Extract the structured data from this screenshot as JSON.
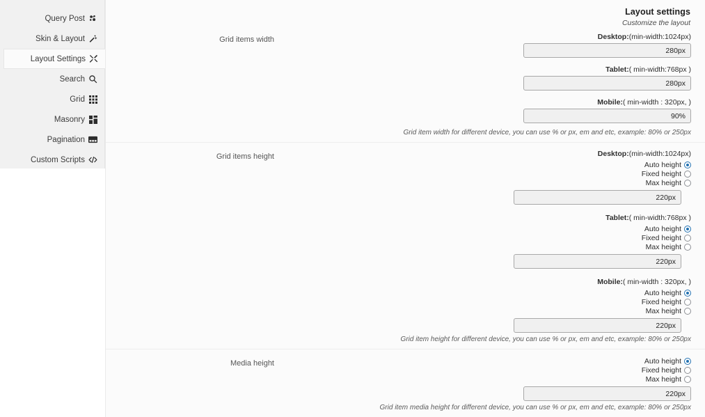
{
  "sidebar": {
    "items": [
      {
        "label": "Query Post",
        "icon": "query-post-icon",
        "active": false
      },
      {
        "label": "Skin & Layout",
        "icon": "magic-wand-icon",
        "active": false
      },
      {
        "label": "Layout Settings",
        "icon": "tools-icon",
        "active": true
      },
      {
        "label": "Search",
        "icon": "search-icon",
        "active": false
      },
      {
        "label": "Grid",
        "icon": "grid-icon",
        "active": false
      },
      {
        "label": "Masonry",
        "icon": "masonry-icon",
        "active": false
      },
      {
        "label": "Pagination",
        "icon": "pagination-icon",
        "active": false
      },
      {
        "label": "Custom Scripts",
        "icon": "code-icon",
        "active": false
      }
    ]
  },
  "panel": {
    "title": "Layout settings",
    "subtitle": "Customize the layout"
  },
  "sections": {
    "grid_items_width": {
      "label": "Grid items width",
      "desktop_label_bold": "Desktop:",
      "desktop_label_rest": "(min-width:1024px)",
      "desktop_value": "280px",
      "tablet_label_bold": "Tablet:",
      "tablet_label_rest": "( min-width:768px )",
      "tablet_value": "280px",
      "mobile_label_bold": "Mobile:",
      "mobile_label_rest": "( min-width : 320px, )",
      "mobile_value": "90%",
      "helper": "Grid item width for different device, you can use % or px, em and etc, example: 80% or 250px"
    },
    "grid_items_height": {
      "label": "Grid items height",
      "desktop_label_bold": "Desktop:",
      "desktop_label_rest": "(min-width:1024px)",
      "tablet_label_bold": "Tablet:",
      "tablet_label_rest": "( min-width:768px )",
      "mobile_label_bold": "Mobile:",
      "mobile_label_rest": "( min-width : 320px, )",
      "radio_auto": "Auto height",
      "radio_fixed": "Fixed height",
      "radio_max": "Max height",
      "desktop_value": "220px",
      "tablet_value": "220px",
      "mobile_value": "220px",
      "helper": "Grid item height for different device, you can use % or px, em and etc, example: 80% or 250px"
    },
    "media_height": {
      "label": "Media height",
      "radio_auto": "Auto height",
      "radio_fixed": "Fixed height",
      "radio_max": "Max height",
      "value": "220px",
      "helper": "Grid item media height for different device, you can use % or px, em and etc, example: 80% or 250px"
    }
  },
  "colors": {
    "accent": "#2271b1",
    "sidebar_bg": "#f1f1f1",
    "panel_bg": "#fbfbfb",
    "input_bg": "#f0f0f0"
  }
}
